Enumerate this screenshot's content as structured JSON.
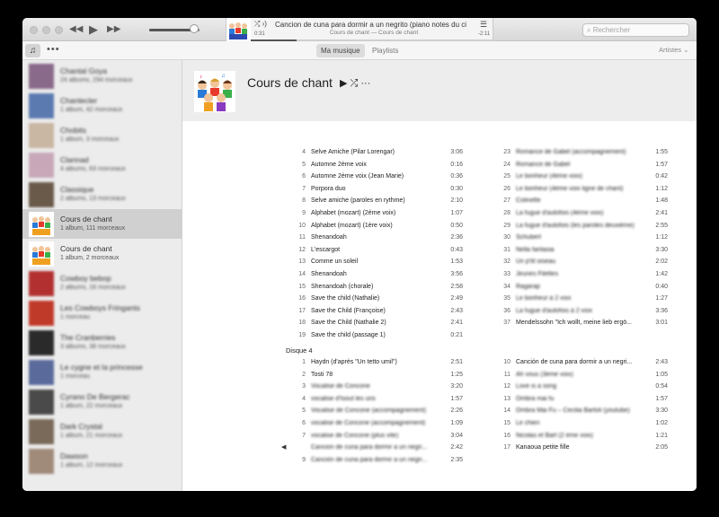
{
  "player": {
    "prev": "◀◀",
    "play": "▶",
    "next": "▶▶",
    "volume_level": 0.9,
    "now_playing_title": "Cancion de cuna para dormir a un negrito (piano notes du ci",
    "now_playing_sub": "Cours de chant — Cours de chant",
    "elapsed": "0:31",
    "remaining": "-2:11",
    "progress": 0.19
  },
  "search": {
    "placeholder": "Rechercher"
  },
  "toolbar": {
    "tabs": [
      "Ma musique",
      "Playlists"
    ],
    "sort_label": "Artistes"
  },
  "sidebar": {
    "items": [
      {
        "name": "Chantal Goya",
        "info": "24 albums, 294 morceaux",
        "blurred": true,
        "color": "#8a6a8a"
      },
      {
        "name": "Chantecler",
        "info": "1 album, 42 morceaux",
        "blurred": true,
        "color": "#5b7ab0"
      },
      {
        "name": "Chobits",
        "info": "1 album, 3 morceaux",
        "blurred": true,
        "color": "#c9b6a3"
      },
      {
        "name": "Clannad",
        "info": "4 albums, 63 morceaux",
        "blurred": true,
        "color": "#c8a7b8"
      },
      {
        "name": "Classique",
        "info": "2 albums, 13 morceaux",
        "blurred": true,
        "color": "#6a5a4a"
      },
      {
        "name": "Cours de chant",
        "info": "1 album, 111 morceaux",
        "blurred": false,
        "color": "#e8d84a"
      },
      {
        "name": "Cours de chant",
        "info": "1 album, 2 morceaux",
        "blurred": false,
        "color": "#e8d84a"
      },
      {
        "name": "Cowboy bebop",
        "info": "2 albums, 16 morceaux",
        "blurred": true,
        "color": "#b23030"
      },
      {
        "name": "Les Cowboys Fringants",
        "info": "1 morceau",
        "blurred": true,
        "color": "#c03a2a"
      },
      {
        "name": "The Cranberries",
        "info": "3 albums, 38 morceaux",
        "blurred": true,
        "color": "#2a2a2a"
      },
      {
        "name": "Le cygne et la princesse",
        "info": "1 morceau",
        "blurred": true,
        "color": "#5a6a9a"
      },
      {
        "name": "Cyrano De Bergerac",
        "info": "1 album, 22 morceaux",
        "blurred": true,
        "color": "#4a4a4a"
      },
      {
        "name": "Dark Crystal",
        "info": "1 album, 21 morceaux",
        "blurred": true,
        "color": "#7a6a5a"
      },
      {
        "name": "Dawson",
        "info": "1 album, 12 morceaux",
        "blurred": true,
        "color": "#a08a7a"
      }
    ]
  },
  "album": {
    "title": "Cours de chant",
    "controls": "▶ ⤮ ···"
  },
  "tracks_left": [
    {
      "n": "4",
      "t": "Selve Amiche (Pilar Lorengar)",
      "d": "3:06",
      "b": false
    },
    {
      "n": "5",
      "t": "Automne 2ème voix",
      "d": "0:16",
      "b": false
    },
    {
      "n": "6",
      "t": "Automne 2ème voix (Jean Marie)",
      "d": "0:36",
      "b": false
    },
    {
      "n": "7",
      "t": "Porpora duo",
      "d": "0:30",
      "b": false
    },
    {
      "n": "8",
      "t": "Selve amiche (paroles en rythme)",
      "d": "2:10",
      "b": false
    },
    {
      "n": "9",
      "t": "Alphabet (mozart) (2ème voix)",
      "d": "1:07",
      "b": false
    },
    {
      "n": "10",
      "t": "Alphabet (mozart) (1ère voix)",
      "d": "0:50",
      "b": false
    },
    {
      "n": "11",
      "t": "Shenandoah",
      "d": "2:36",
      "b": false
    },
    {
      "n": "12",
      "t": "L'escargot",
      "d": "0:43",
      "b": false
    },
    {
      "n": "13",
      "t": "Comme un soleil",
      "d": "1:53",
      "b": false
    },
    {
      "n": "14",
      "t": "Shenandoah",
      "d": "3:56",
      "b": false
    },
    {
      "n": "15",
      "t": "Shenandoah (chorale)",
      "d": "2:58",
      "b": false
    },
    {
      "n": "16",
      "t": "Save the child (Nathalie)",
      "d": "2:49",
      "b": false
    },
    {
      "n": "17",
      "t": "Save the Child (Françoise)",
      "d": "2:43",
      "b": false
    },
    {
      "n": "18",
      "t": "Save the Child (Nathalie 2)",
      "d": "2:41",
      "b": false
    },
    {
      "n": "19",
      "t": "Save the child (passage 1)",
      "d": "0:21",
      "b": false
    }
  ],
  "tracks_right": [
    {
      "n": "23",
      "t": "Romance de Gabel (accompagnement)",
      "d": "1:55",
      "b": true
    },
    {
      "n": "24",
      "t": "Romance de Gabel",
      "d": "1:57",
      "b": true
    },
    {
      "n": "25",
      "t": "Le bonheur (4ème voix)",
      "d": "0:42",
      "b": true
    },
    {
      "n": "26",
      "t": "Le bonheur (4ème voix ligne de chant)",
      "d": "1:12",
      "b": true
    },
    {
      "n": "27",
      "t": "Colinette",
      "d": "1:48",
      "b": true
    },
    {
      "n": "28",
      "t": "La fugue d'autofois (4ème voix)",
      "d": "2:41",
      "b": true
    },
    {
      "n": "29",
      "t": "La fugue d'autofois (les paroles deuxième)",
      "d": "2:55",
      "b": true
    },
    {
      "n": "30",
      "t": "Schubert",
      "d": "1:12",
      "b": true
    },
    {
      "n": "31",
      "t": "Nella fantasia",
      "d": "3:30",
      "b": true
    },
    {
      "n": "32",
      "t": "Un p'tit oiseau",
      "d": "2:02",
      "b": true
    },
    {
      "n": "33",
      "t": "Jeunes Filettes",
      "d": "1:42",
      "b": true
    },
    {
      "n": "34",
      "t": "Ragarap",
      "d": "0:40",
      "b": true
    },
    {
      "n": "35",
      "t": "Le bonheur à 2 voix",
      "d": "1:27",
      "b": true
    },
    {
      "n": "36",
      "t": "La fugue d'autofois à 2 voix",
      "d": "3:36",
      "b": true
    },
    {
      "n": "37",
      "t": "Mendelssohn \"Ich wollt, meine lieb ergö...",
      "d": "3:01",
      "b": false
    }
  ],
  "disc4_label": "Disque 4",
  "disc4_left": [
    {
      "n": "1",
      "t": "Haydn (d'après \"Un tetto umil\")",
      "d": "2:51",
      "b": false
    },
    {
      "n": "2",
      "t": "Tosti 78",
      "d": "1:25",
      "b": false
    },
    {
      "n": "3",
      "t": "Vocalise de Concone",
      "d": "3:20",
      "b": true
    },
    {
      "n": "4",
      "t": "vocalise d'Isout les uns",
      "d": "1:57",
      "b": true
    },
    {
      "n": "5",
      "t": "Vocalise de Concone (accompagnement)",
      "d": "2:26",
      "b": true
    },
    {
      "n": "6",
      "t": "vocalise de Concone (accompagnement)",
      "d": "1:09",
      "b": true
    },
    {
      "n": "7",
      "t": "vocalise de Concone (plus vite)",
      "d": "3:04",
      "b": true
    },
    {
      "n": "",
      "t": "Cancion de cuna para dormir a un negri...",
      "d": "2:42",
      "b": true
    },
    {
      "n": "9",
      "t": "Canción de cuna para dormir a un negri...",
      "d": "2:35",
      "b": true
    }
  ],
  "disc4_right": [
    {
      "n": "10",
      "t": "Canción de cuna para dormir a un negri...",
      "d": "2:43",
      "b": false
    },
    {
      "n": "11",
      "t": "Ah vous (3ème voix)",
      "d": "1:05",
      "b": true
    },
    {
      "n": "12",
      "t": "Love is a song",
      "d": "0:54",
      "b": true
    },
    {
      "n": "13",
      "t": "Ombra mai fu",
      "d": "1:57",
      "b": true
    },
    {
      "n": "14",
      "t": "Ombra Mai Fu – Cecilia Bartoli (youtube)",
      "d": "3:30",
      "b": true
    },
    {
      "n": "15",
      "t": "Le chien",
      "d": "1:02",
      "b": true
    },
    {
      "n": "16",
      "t": "Nicolas et Bart (2 ème voix)",
      "d": "1:21",
      "b": true
    },
    {
      "n": "17",
      "t": "Kanaoua petite fille",
      "d": "2:05",
      "b": false
    }
  ],
  "colors": {
    "accent": "#dcdcdc",
    "selected": "#d0d0d0"
  }
}
